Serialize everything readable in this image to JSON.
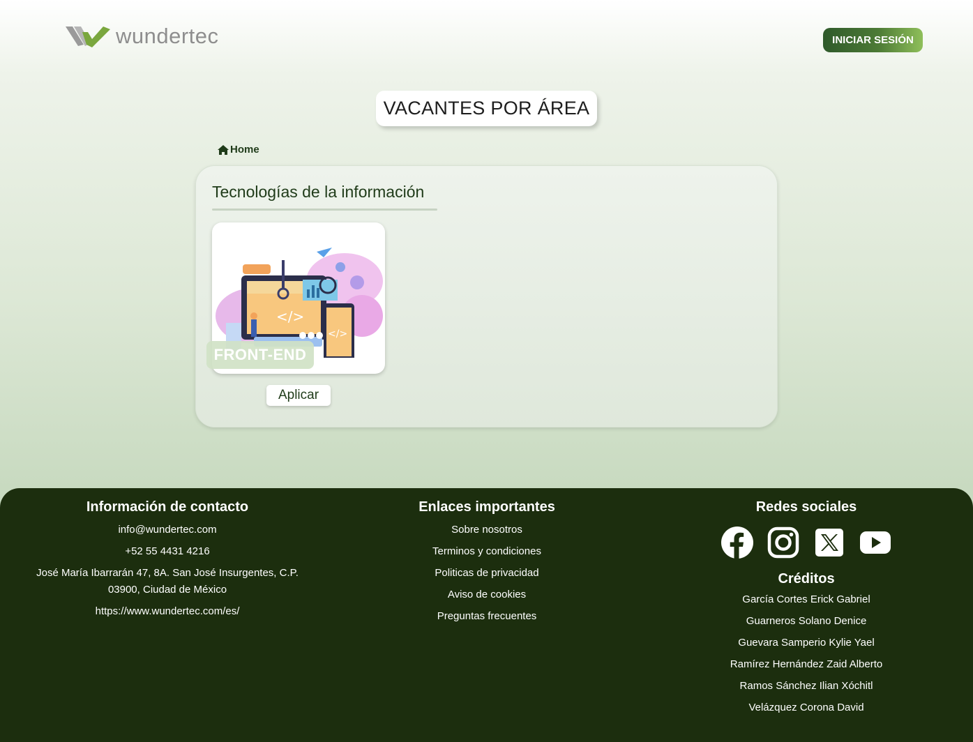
{
  "header": {
    "logo_text": "wundertec",
    "login_label": "INICIAR SESIÓN"
  },
  "page": {
    "title": "VACANTES POR ÁREA",
    "breadcrumb": "Home"
  },
  "section": {
    "title": "Tecnologías de la información",
    "cards": [
      {
        "label": "FRONT-END",
        "apply_label": "Aplicar"
      }
    ]
  },
  "footer": {
    "contact": {
      "title": "Información de contacto",
      "email": "info@wundertec.com",
      "phone": "+52 55 4431 4216",
      "address": "José María Ibarrarán 47, 8A. San José Insurgentes, C.P. 03900, Ciudad de México",
      "website": "https://www.wundertec.com/es/"
    },
    "links": {
      "title": "Enlaces importantes",
      "items": [
        "Sobre nosotros",
        "Terminos y condiciones",
        "Politicas de privacidad",
        "Aviso de cookies",
        "Preguntas frecuentes"
      ]
    },
    "social": {
      "title": "Redes sociales",
      "icons": [
        "facebook-icon",
        "instagram-icon",
        "x-icon",
        "youtube-icon"
      ]
    },
    "credits": {
      "title": "Créditos",
      "names": [
        "García Cortes Erick Gabriel",
        "Guarneros Solano Denice",
        "Guevara Samperio Kylie Yael",
        "Ramírez Hernández Zaid Alberto",
        "Ramos Sánchez Ilian Xóchitl",
        "Velázquez Corona David"
      ]
    }
  },
  "colors": {
    "brand_green_dark": "#1c2e0e",
    "brand_green": "#2f5a2b",
    "brand_green_light": "#8fbf5a"
  }
}
